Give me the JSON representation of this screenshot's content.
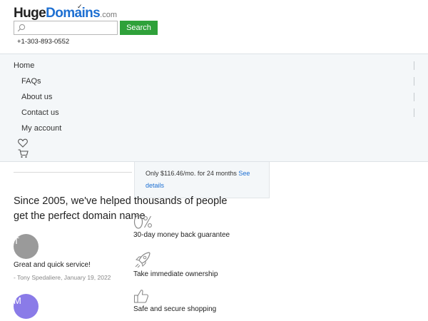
{
  "header": {
    "logo": {
      "part1": "Huge",
      "part2": "Domains",
      "suffix": ".com"
    },
    "search": {
      "placeholder": "",
      "value": "",
      "button_label": "Search"
    },
    "phone": "+1-303-893-0552"
  },
  "nav": {
    "items": [
      {
        "label": "Home"
      },
      {
        "label": "FAQs"
      },
      {
        "label": "About us"
      },
      {
        "label": "Contact us"
      },
      {
        "label": "My account"
      }
    ],
    "icons": [
      "heart-icon",
      "cart-icon"
    ]
  },
  "popup": {
    "text": "Only $116.46/mo. for 24 months",
    "link_label": "See details"
  },
  "tagline": "Since 2005, we've helped thousands of people get the perfect domain name",
  "reviews": [
    {
      "initial": "T",
      "avatar_color": "#9a9a9a",
      "text": "Great and quick service!",
      "meta": "- Tony Spedaliere, January 19, 2022"
    },
    {
      "initial": "M",
      "avatar_color": "#8a7be8"
    }
  ],
  "benefits": [
    {
      "icon": "zero-percent-icon",
      "label": "30-day money back guarantee"
    },
    {
      "icon": "rocket-icon",
      "label": "Take immediate ownership"
    },
    {
      "icon": "thumbs-up-icon",
      "label": "Safe and secure shopping"
    }
  ],
  "colors": {
    "brand_blue": "#1d6fd2",
    "search_green": "#2fa13a",
    "nav_bg": "#f4f7f9"
  }
}
